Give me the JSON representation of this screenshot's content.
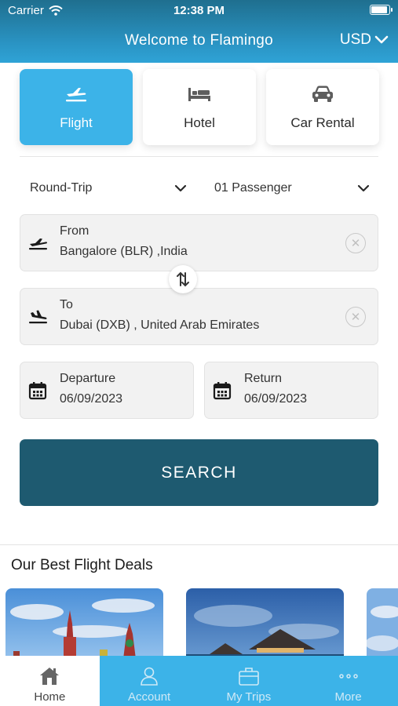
{
  "status_bar": {
    "carrier": "Carrier",
    "time": "12:38 PM"
  },
  "header": {
    "title": "Welcome to Flamingo",
    "currency": "USD"
  },
  "tabs": [
    {
      "label": "Flight",
      "icon": "airplane-icon",
      "active": true
    },
    {
      "label": "Hotel",
      "icon": "bed-icon",
      "active": false
    },
    {
      "label": "Car Rental",
      "icon": "car-icon",
      "active": false
    }
  ],
  "trip_type": "Round-Trip",
  "passengers": "01 Passenger",
  "from": {
    "label": "From",
    "value": "Bangalore (BLR) ,India"
  },
  "to": {
    "label": "To",
    "value": "Dubai (DXB) , United Arab Emirates"
  },
  "departure": {
    "label": "Departure",
    "value": "06/09/2023"
  },
  "return": {
    "label": "Return",
    "value": "06/09/2023"
  },
  "search_label": "SEARCH",
  "deals": {
    "title": "Our Best Flight Deals"
  },
  "nav": [
    {
      "label": "Home",
      "icon": "home-icon",
      "active": true
    },
    {
      "label": "Account",
      "icon": "user-icon",
      "active": false
    },
    {
      "label": "My Trips",
      "icon": "briefcase-icon",
      "active": false
    },
    {
      "label": "More",
      "icon": "more-icon",
      "active": false
    }
  ],
  "colors": {
    "accent": "#3cb3e8",
    "header_dark": "#1f6f8f",
    "button": "#1e5a70"
  }
}
